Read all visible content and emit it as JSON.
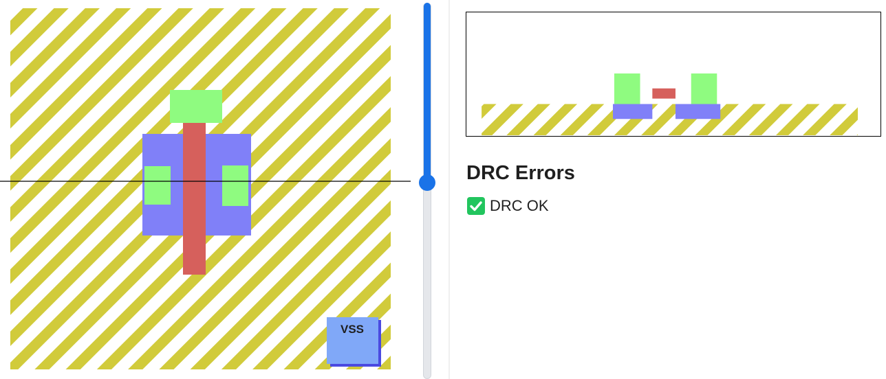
{
  "layout": {
    "pin_label": "VSS",
    "colors": {
      "nwell_stripe": "#d1cb3b",
      "diffusion": "#8080f8",
      "poly": "#d6605c",
      "contact": "#8ffb80",
      "pin": "#80a8f8",
      "pin_edge": "#4a4ae0",
      "cut_line": "#000000"
    }
  },
  "depth_slider": {
    "value_fraction": 0.48,
    "accent_color": "#1a73e8"
  },
  "drc": {
    "title": "DRC Errors",
    "status_text": "DRC OK",
    "status_icon": "check-mark-icon",
    "status_color": "#22c55e"
  }
}
